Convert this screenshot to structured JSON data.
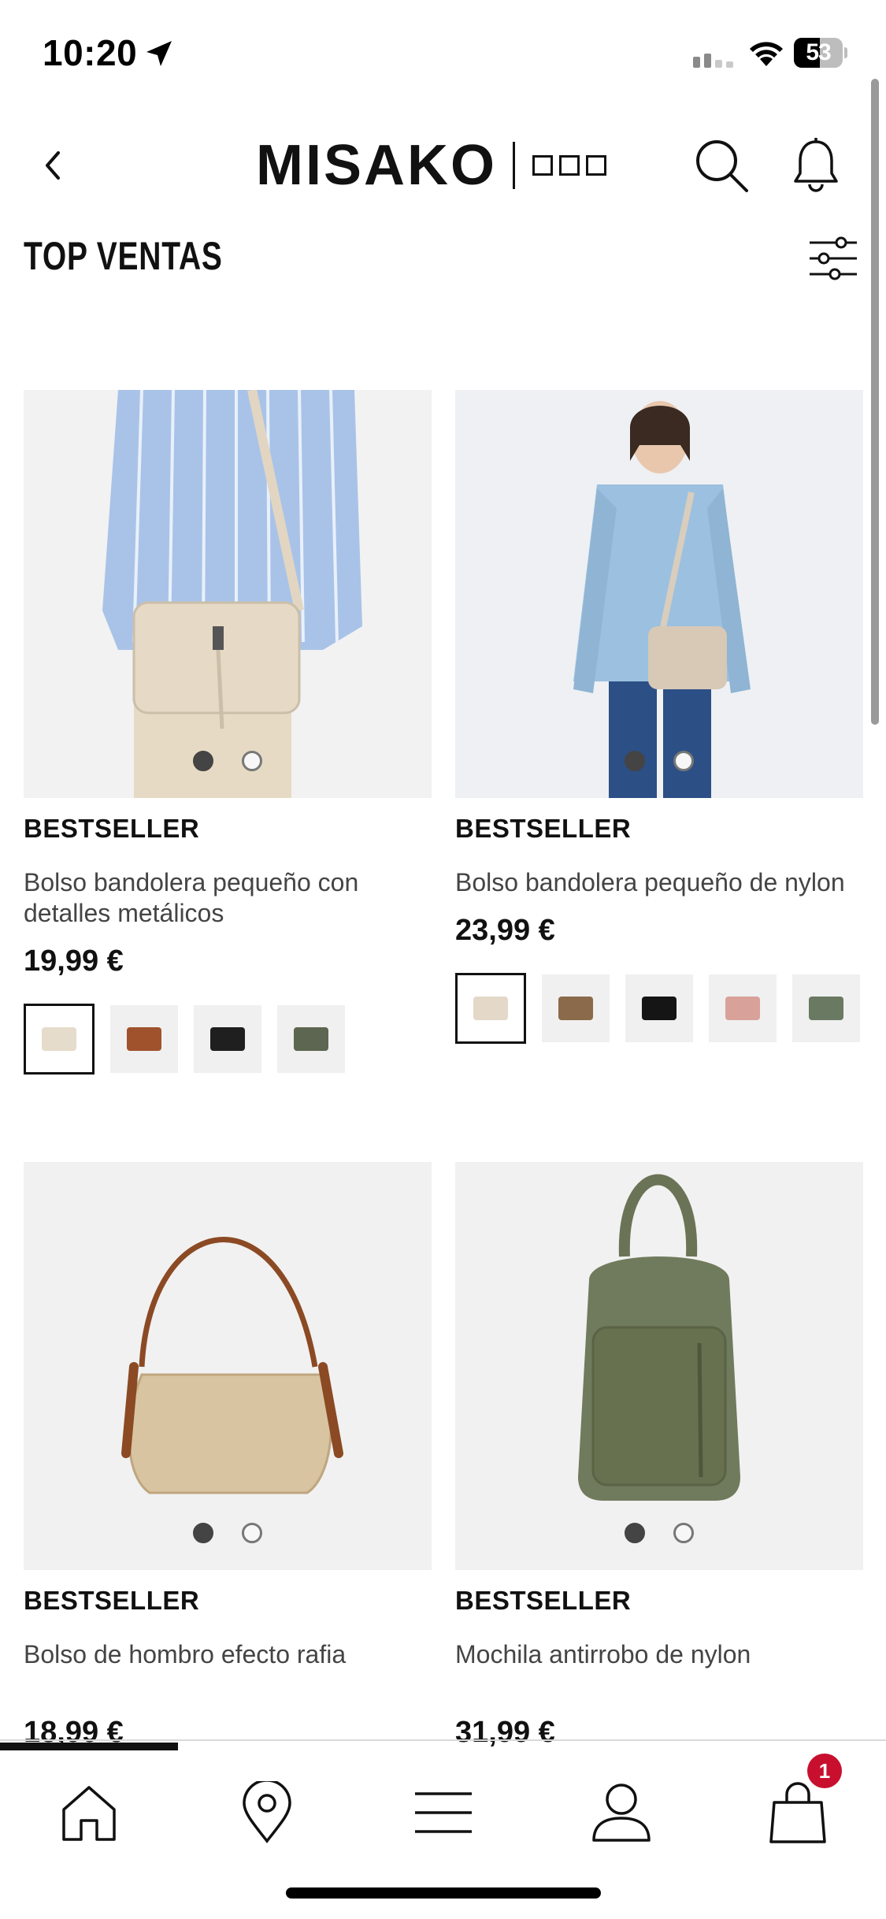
{
  "status_bar": {
    "time": "10:20",
    "battery": "53",
    "battery_level": 0.53
  },
  "header": {
    "brand": "MISAKO",
    "icons": [
      "back-arrow-icon",
      "search-icon",
      "bell-icon"
    ]
  },
  "page": {
    "title": "TOP VENTAS",
    "filter_icon": "sliders-icon"
  },
  "products": [
    {
      "badge": "BESTSELLER",
      "name": "Bolso bandolera pequeño con detalles metálicos",
      "price": "19,99 €",
      "swatch_colors": [
        "#e6dccb",
        "#a0522d",
        "#1f1f1f",
        "#5d6650"
      ]
    },
    {
      "badge": "BESTSELLER",
      "name": "Bolso bandolera pequeño de nylon",
      "price": "23,99 €",
      "swatch_colors": [
        "#e4d8c8",
        "#8a6a4a",
        "#151515",
        "#d8a29a",
        "#6a7a62"
      ]
    },
    {
      "badge": "BESTSELLER",
      "name": "Bolso de hombro efecto rafia",
      "price": "18,99 €",
      "swatch_colors": []
    },
    {
      "badge": "BESTSELLER",
      "name": "Mochila antirrobo de nylon",
      "price": "31,99 €",
      "swatch_colors": []
    }
  ],
  "bottom_nav": {
    "items": [
      "home-icon",
      "location-pin-icon",
      "menu-icon",
      "user-icon",
      "shopping-bag-icon"
    ],
    "cart_count": "1"
  },
  "colors": {
    "accent": "#c8102e",
    "text": "#111111",
    "image_bg": "#f1f1f1"
  }
}
